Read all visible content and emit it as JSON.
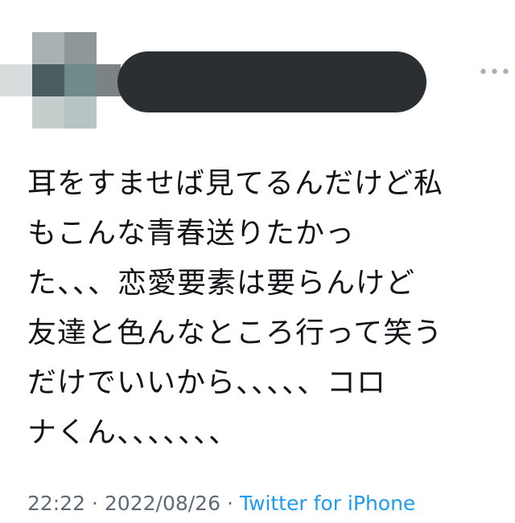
{
  "tweet": {
    "text_lines": [
      "耳をすませば見てるんだけど私",
      "もこんな青春送りたかっ",
      "た、、、恋愛要素は要らんけど",
      "友達と色んなところ行って笑う",
      "だけでいいから、、、、、コロ",
      "ナくん、、、、、、、"
    ],
    "time": "22:22",
    "separator": "·",
    "date": "2022/08/26",
    "source": "Twitter for iPhone",
    "more_icon_text": "•••"
  },
  "colors": {
    "text": "#111418",
    "meta": "#5e6a75",
    "link": "#1d9bf0",
    "redaction": "#2b2f32"
  }
}
